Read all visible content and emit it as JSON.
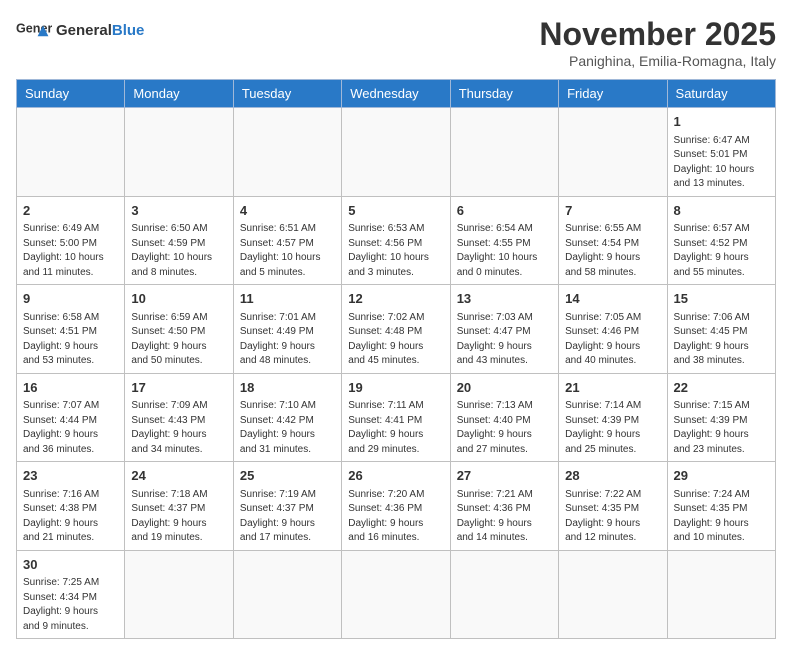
{
  "header": {
    "logo_general": "General",
    "logo_blue": "Blue",
    "month_title": "November 2025",
    "subtitle": "Panighina, Emilia-Romagna, Italy"
  },
  "days_of_week": [
    "Sunday",
    "Monday",
    "Tuesday",
    "Wednesday",
    "Thursday",
    "Friday",
    "Saturday"
  ],
  "weeks": [
    [
      {
        "day": "",
        "info": ""
      },
      {
        "day": "",
        "info": ""
      },
      {
        "day": "",
        "info": ""
      },
      {
        "day": "",
        "info": ""
      },
      {
        "day": "",
        "info": ""
      },
      {
        "day": "",
        "info": ""
      },
      {
        "day": "1",
        "info": "Sunrise: 6:47 AM\nSunset: 5:01 PM\nDaylight: 10 hours\nand 13 minutes."
      }
    ],
    [
      {
        "day": "2",
        "info": "Sunrise: 6:49 AM\nSunset: 5:00 PM\nDaylight: 10 hours\nand 11 minutes."
      },
      {
        "day": "3",
        "info": "Sunrise: 6:50 AM\nSunset: 4:59 PM\nDaylight: 10 hours\nand 8 minutes."
      },
      {
        "day": "4",
        "info": "Sunrise: 6:51 AM\nSunset: 4:57 PM\nDaylight: 10 hours\nand 5 minutes."
      },
      {
        "day": "5",
        "info": "Sunrise: 6:53 AM\nSunset: 4:56 PM\nDaylight: 10 hours\nand 3 minutes."
      },
      {
        "day": "6",
        "info": "Sunrise: 6:54 AM\nSunset: 4:55 PM\nDaylight: 10 hours\nand 0 minutes."
      },
      {
        "day": "7",
        "info": "Sunrise: 6:55 AM\nSunset: 4:54 PM\nDaylight: 9 hours\nand 58 minutes."
      },
      {
        "day": "8",
        "info": "Sunrise: 6:57 AM\nSunset: 4:52 PM\nDaylight: 9 hours\nand 55 minutes."
      }
    ],
    [
      {
        "day": "9",
        "info": "Sunrise: 6:58 AM\nSunset: 4:51 PM\nDaylight: 9 hours\nand 53 minutes."
      },
      {
        "day": "10",
        "info": "Sunrise: 6:59 AM\nSunset: 4:50 PM\nDaylight: 9 hours\nand 50 minutes."
      },
      {
        "day": "11",
        "info": "Sunrise: 7:01 AM\nSunset: 4:49 PM\nDaylight: 9 hours\nand 48 minutes."
      },
      {
        "day": "12",
        "info": "Sunrise: 7:02 AM\nSunset: 4:48 PM\nDaylight: 9 hours\nand 45 minutes."
      },
      {
        "day": "13",
        "info": "Sunrise: 7:03 AM\nSunset: 4:47 PM\nDaylight: 9 hours\nand 43 minutes."
      },
      {
        "day": "14",
        "info": "Sunrise: 7:05 AM\nSunset: 4:46 PM\nDaylight: 9 hours\nand 40 minutes."
      },
      {
        "day": "15",
        "info": "Sunrise: 7:06 AM\nSunset: 4:45 PM\nDaylight: 9 hours\nand 38 minutes."
      }
    ],
    [
      {
        "day": "16",
        "info": "Sunrise: 7:07 AM\nSunset: 4:44 PM\nDaylight: 9 hours\nand 36 minutes."
      },
      {
        "day": "17",
        "info": "Sunrise: 7:09 AM\nSunset: 4:43 PM\nDaylight: 9 hours\nand 34 minutes."
      },
      {
        "day": "18",
        "info": "Sunrise: 7:10 AM\nSunset: 4:42 PM\nDaylight: 9 hours\nand 31 minutes."
      },
      {
        "day": "19",
        "info": "Sunrise: 7:11 AM\nSunset: 4:41 PM\nDaylight: 9 hours\nand 29 minutes."
      },
      {
        "day": "20",
        "info": "Sunrise: 7:13 AM\nSunset: 4:40 PM\nDaylight: 9 hours\nand 27 minutes."
      },
      {
        "day": "21",
        "info": "Sunrise: 7:14 AM\nSunset: 4:39 PM\nDaylight: 9 hours\nand 25 minutes."
      },
      {
        "day": "22",
        "info": "Sunrise: 7:15 AM\nSunset: 4:39 PM\nDaylight: 9 hours\nand 23 minutes."
      }
    ],
    [
      {
        "day": "23",
        "info": "Sunrise: 7:16 AM\nSunset: 4:38 PM\nDaylight: 9 hours\nand 21 minutes."
      },
      {
        "day": "24",
        "info": "Sunrise: 7:18 AM\nSunset: 4:37 PM\nDaylight: 9 hours\nand 19 minutes."
      },
      {
        "day": "25",
        "info": "Sunrise: 7:19 AM\nSunset: 4:37 PM\nDaylight: 9 hours\nand 17 minutes."
      },
      {
        "day": "26",
        "info": "Sunrise: 7:20 AM\nSunset: 4:36 PM\nDaylight: 9 hours\nand 16 minutes."
      },
      {
        "day": "27",
        "info": "Sunrise: 7:21 AM\nSunset: 4:36 PM\nDaylight: 9 hours\nand 14 minutes."
      },
      {
        "day": "28",
        "info": "Sunrise: 7:22 AM\nSunset: 4:35 PM\nDaylight: 9 hours\nand 12 minutes."
      },
      {
        "day": "29",
        "info": "Sunrise: 7:24 AM\nSunset: 4:35 PM\nDaylight: 9 hours\nand 10 minutes."
      }
    ],
    [
      {
        "day": "30",
        "info": "Sunrise: 7:25 AM\nSunset: 4:34 PM\nDaylight: 9 hours\nand 9 minutes."
      },
      {
        "day": "",
        "info": ""
      },
      {
        "day": "",
        "info": ""
      },
      {
        "day": "",
        "info": ""
      },
      {
        "day": "",
        "info": ""
      },
      {
        "day": "",
        "info": ""
      },
      {
        "day": "",
        "info": ""
      }
    ]
  ]
}
